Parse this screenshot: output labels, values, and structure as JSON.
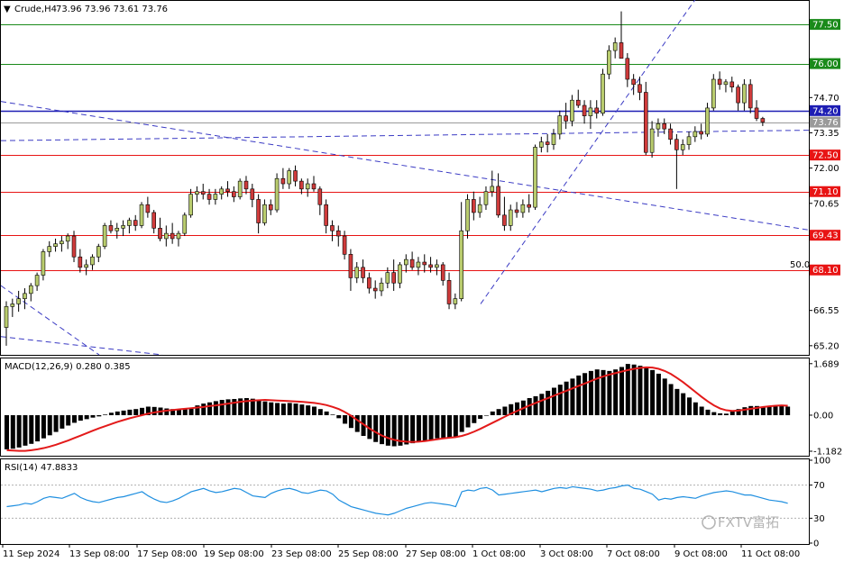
{
  "header": {
    "symbol": "Crude,H4",
    "ohlc": "73.96 73.96 73.61 73.76"
  },
  "watermark": "FXTV富拓",
  "colors": {
    "background": "#ffffff",
    "candle_up": "#b9cc6e",
    "candle_down": "#cf3b3b",
    "macd_hist": "#000000",
    "macd_signal": "#e31a1a",
    "rsi_line": "#1f8fe0",
    "green_level": "#1a8a1a",
    "red_level": "#e81414",
    "blue_level": "#1e1eb4",
    "gray_level": "#9a9a9a",
    "trend_dash": "#3b3bc4"
  },
  "chart_data": [
    {
      "type": "candlestick",
      "title": "Crude,H4",
      "x_ticks": [
        "11 Sep 2024",
        "13 Sep 08:00",
        "17 Sep 08:00",
        "19 Sep 08:00",
        "23 Sep 08:00",
        "25 Sep 08:00",
        "27 Sep 08:00",
        "1 Oct 08:00",
        "3 Oct 08:00",
        "7 Oct 08:00",
        "9 Oct 08:00",
        "11 Oct 08:00"
      ],
      "y_ticks": [
        65.2,
        66.55,
        70.65,
        72.0,
        73.35,
        74.7
      ],
      "ylim": [
        64.85,
        78.4
      ],
      "current_price": 73.76,
      "levels": [
        {
          "value": 77.5,
          "label": "77.50",
          "kind": "green"
        },
        {
          "value": 76.0,
          "label": "76.00",
          "kind": "green"
        },
        {
          "value": 74.2,
          "label": "74.20",
          "kind": "blue"
        },
        {
          "value": 73.76,
          "label": "73.76",
          "kind": "gray"
        },
        {
          "value": 72.5,
          "label": "72.50",
          "kind": "red"
        },
        {
          "value": 71.1,
          "label": "71.10",
          "kind": "red"
        },
        {
          "value": 69.43,
          "label": "69.43",
          "kind": "red"
        },
        {
          "value": 68.1,
          "label": "68.10",
          "kind": "red"
        }
      ],
      "fib_label": "50.0",
      "candles": [
        [
          65.9,
          66.9,
          65.2,
          66.7
        ],
        [
          66.7,
          67.0,
          66.3,
          66.8
        ],
        [
          66.8,
          67.3,
          66.5,
          67.0
        ],
        [
          67.0,
          67.4,
          66.6,
          67.2
        ],
        [
          67.2,
          67.6,
          66.9,
          67.5
        ],
        [
          67.5,
          68.0,
          67.3,
          67.9
        ],
        [
          67.9,
          68.9,
          67.7,
          68.8
        ],
        [
          68.8,
          69.2,
          68.6,
          69.0
        ],
        [
          69.0,
          69.3,
          68.8,
          69.1
        ],
        [
          69.1,
          69.4,
          68.8,
          69.2
        ],
        [
          69.2,
          69.5,
          68.9,
          69.4
        ],
        [
          69.4,
          69.6,
          68.4,
          68.6
        ],
        [
          68.6,
          68.9,
          68.0,
          68.2
        ],
        [
          68.2,
          68.5,
          67.9,
          68.3
        ],
        [
          68.3,
          68.7,
          68.1,
          68.6
        ],
        [
          68.6,
          69.1,
          68.4,
          69.0
        ],
        [
          69.0,
          69.9,
          68.9,
          69.8
        ],
        [
          69.8,
          70.0,
          69.5,
          69.6
        ],
        [
          69.6,
          69.9,
          69.3,
          69.7
        ],
        [
          69.7,
          70.0,
          69.4,
          69.8
        ],
        [
          69.8,
          70.1,
          69.5,
          70.0
        ],
        [
          70.0,
          70.2,
          69.6,
          69.8
        ],
        [
          69.8,
          70.7,
          69.7,
          70.6
        ],
        [
          70.6,
          70.9,
          70.1,
          70.3
        ],
        [
          70.3,
          70.4,
          69.5,
          69.7
        ],
        [
          69.7,
          70.1,
          69.2,
          69.3
        ],
        [
          69.3,
          69.8,
          69.0,
          69.5
        ],
        [
          69.5,
          69.9,
          69.1,
          69.3
        ],
        [
          69.3,
          69.6,
          69.0,
          69.5
        ],
        [
          69.5,
          70.3,
          69.4,
          70.2
        ],
        [
          70.2,
          71.2,
          70.1,
          71.0
        ],
        [
          71.0,
          71.3,
          70.7,
          71.1
        ],
        [
          71.1,
          71.4,
          70.8,
          71.0
        ],
        [
          71.0,
          71.2,
          70.6,
          70.8
        ],
        [
          70.8,
          71.2,
          70.6,
          71.0
        ],
        [
          71.0,
          71.3,
          70.8,
          71.2
        ],
        [
          71.2,
          71.5,
          70.9,
          71.1
        ],
        [
          71.1,
          71.3,
          70.7,
          70.9
        ],
        [
          70.9,
          71.6,
          70.8,
          71.5
        ],
        [
          71.5,
          71.7,
          71.0,
          71.2
        ],
        [
          71.2,
          71.4,
          70.5,
          70.8
        ],
        [
          70.8,
          71.0,
          69.5,
          69.9
        ],
        [
          69.9,
          70.8,
          69.8,
          70.6
        ],
        [
          70.6,
          70.8,
          70.2,
          70.4
        ],
        [
          70.4,
          71.8,
          70.3,
          71.6
        ],
        [
          71.6,
          72.0,
          71.2,
          71.4
        ],
        [
          71.4,
          72.0,
          71.2,
          71.9
        ],
        [
          71.9,
          72.1,
          71.3,
          71.5
        ],
        [
          71.5,
          71.6,
          71.0,
          71.2
        ],
        [
          71.2,
          71.6,
          70.9,
          71.4
        ],
        [
          71.4,
          71.7,
          71.1,
          71.2
        ],
        [
          71.2,
          71.3,
          70.2,
          70.6
        ],
        [
          70.6,
          70.8,
          69.5,
          69.8
        ],
        [
          69.8,
          70.0,
          69.2,
          69.6
        ],
        [
          69.6,
          69.8,
          69.0,
          69.4
        ],
        [
          69.4,
          69.6,
          68.5,
          68.7
        ],
        [
          68.7,
          68.9,
          67.3,
          67.8
        ],
        [
          67.8,
          68.4,
          67.6,
          68.2
        ],
        [
          68.2,
          68.5,
          67.6,
          67.8
        ],
        [
          67.8,
          68.0,
          67.2,
          67.4
        ],
        [
          67.4,
          67.7,
          67.0,
          67.3
        ],
        [
          67.3,
          67.8,
          67.1,
          67.6
        ],
        [
          67.6,
          68.2,
          67.4,
          68.0
        ],
        [
          68.0,
          68.5,
          67.3,
          67.6
        ],
        [
          67.6,
          68.4,
          67.4,
          68.3
        ],
        [
          68.3,
          68.7,
          68.0,
          68.5
        ],
        [
          68.5,
          68.8,
          68.1,
          68.2
        ],
        [
          68.2,
          68.6,
          67.9,
          68.4
        ],
        [
          68.4,
          68.7,
          68.0,
          68.3
        ],
        [
          68.3,
          68.6,
          68.0,
          68.2
        ],
        [
          68.2,
          68.5,
          67.9,
          68.3
        ],
        [
          68.3,
          68.4,
          67.5,
          67.7
        ],
        [
          67.7,
          68.0,
          66.6,
          66.8
        ],
        [
          66.8,
          67.2,
          66.6,
          67.0
        ],
        [
          67.0,
          70.7,
          66.9,
          69.6
        ],
        [
          69.6,
          71.0,
          69.3,
          70.8
        ],
        [
          70.8,
          71.1,
          70.0,
          70.3
        ],
        [
          70.3,
          70.9,
          70.1,
          70.6
        ],
        [
          70.6,
          71.3,
          70.4,
          71.1
        ],
        [
          71.1,
          71.9,
          70.9,
          71.3
        ],
        [
          71.3,
          71.8,
          70.1,
          70.2
        ],
        [
          70.2,
          70.9,
          69.6,
          69.8
        ],
        [
          69.8,
          70.6,
          69.6,
          70.4
        ],
        [
          70.4,
          70.7,
          70.1,
          70.3
        ],
        [
          70.3,
          70.8,
          70.1,
          70.6
        ],
        [
          70.6,
          71.0,
          70.3,
          70.5
        ],
        [
          70.5,
          72.9,
          70.4,
          72.8
        ],
        [
          72.8,
          73.2,
          72.6,
          73.0
        ],
        [
          73.0,
          73.3,
          72.6,
          72.9
        ],
        [
          72.9,
          73.5,
          72.7,
          73.3
        ],
        [
          73.3,
          74.2,
          73.1,
          74.0
        ],
        [
          74.0,
          74.5,
          73.5,
          73.8
        ],
        [
          73.8,
          74.8,
          73.6,
          74.6
        ],
        [
          74.6,
          75.0,
          74.3,
          74.4
        ],
        [
          74.4,
          74.6,
          73.7,
          74.0
        ],
        [
          74.0,
          74.6,
          73.5,
          74.3
        ],
        [
          74.3,
          74.6,
          73.9,
          74.1
        ],
        [
          74.1,
          75.8,
          74.0,
          75.6
        ],
        [
          75.6,
          76.7,
          75.4,
          76.5
        ],
        [
          76.5,
          77.0,
          76.2,
          76.8
        ],
        [
          76.8,
          78.0,
          76.4,
          76.2
        ],
        [
          76.2,
          76.4,
          75.1,
          75.4
        ],
        [
          75.4,
          75.6,
          74.8,
          75.2
        ],
        [
          75.2,
          75.5,
          74.6,
          74.9
        ],
        [
          74.9,
          75.3,
          72.5,
          72.6
        ],
        [
          72.6,
          73.8,
          72.4,
          73.5
        ],
        [
          73.5,
          73.9,
          73.2,
          73.7
        ],
        [
          73.7,
          73.9,
          73.3,
          73.5
        ],
        [
          73.5,
          73.7,
          72.9,
          73.1
        ],
        [
          73.1,
          73.3,
          71.2,
          72.7
        ],
        [
          72.7,
          73.1,
          72.5,
          72.9
        ],
        [
          72.9,
          73.4,
          72.7,
          73.2
        ],
        [
          73.2,
          73.6,
          73.0,
          73.4
        ],
        [
          73.4,
          73.7,
          73.1,
          73.3
        ],
        [
          73.3,
          74.5,
          73.2,
          74.3
        ],
        [
          74.3,
          75.6,
          74.2,
          75.4
        ],
        [
          75.4,
          75.7,
          75.0,
          75.2
        ],
        [
          75.2,
          75.4,
          74.9,
          75.3
        ],
        [
          75.3,
          75.5,
          74.9,
          75.1
        ],
        [
          75.1,
          75.2,
          74.2,
          74.5
        ],
        [
          74.5,
          75.4,
          74.2,
          75.2
        ],
        [
          75.2,
          75.4,
          74.1,
          74.3
        ],
        [
          74.3,
          74.6,
          73.8,
          73.9
        ],
        [
          73.9,
          73.96,
          73.61,
          73.76
        ]
      ]
    },
    {
      "type": "histogram+line",
      "title": "MACD(12,26,9) 0.280 0.385",
      "y_ticks": [
        1.689,
        0.0,
        -1.182
      ],
      "ylim": [
        -1.33,
        1.86
      ],
      "hist": [
        -1.12,
        -1.1,
        -1.06,
        -1.0,
        -0.94,
        -0.86,
        -0.76,
        -0.66,
        -0.55,
        -0.44,
        -0.34,
        -0.25,
        -0.18,
        -0.13,
        -0.08,
        -0.04,
        0.02,
        0.08,
        0.12,
        0.15,
        0.18,
        0.2,
        0.24,
        0.28,
        0.27,
        0.25,
        0.22,
        0.2,
        0.18,
        0.2,
        0.25,
        0.32,
        0.38,
        0.42,
        0.46,
        0.5,
        0.52,
        0.53,
        0.55,
        0.56,
        0.54,
        0.48,
        0.45,
        0.42,
        0.4,
        0.38,
        0.4,
        0.38,
        0.35,
        0.32,
        0.28,
        0.2,
        0.12,
        0.02,
        -0.1,
        -0.28,
        -0.42,
        -0.55,
        -0.68,
        -0.78,
        -0.88,
        -0.95,
        -1.0,
        -1.02,
        -1.0,
        -0.96,
        -0.92,
        -0.88,
        -0.84,
        -0.8,
        -0.76,
        -0.74,
        -0.73,
        -0.7,
        -0.55,
        -0.4,
        -0.26,
        -0.12,
        0.0,
        0.12,
        0.2,
        0.28,
        0.36,
        0.42,
        0.48,
        0.56,
        0.62,
        0.7,
        0.8,
        0.9,
        1.0,
        1.1,
        1.2,
        1.3,
        1.38,
        1.45,
        1.5,
        1.48,
        1.45,
        1.5,
        1.58,
        1.68,
        1.66,
        1.62,
        1.56,
        1.48,
        1.36,
        1.2,
        1.02,
        0.86,
        0.72,
        0.58,
        0.42,
        0.28,
        0.18,
        0.1,
        0.06,
        0.05,
        0.12,
        0.2,
        0.26,
        0.3,
        0.3,
        0.28,
        0.3,
        0.32,
        0.3,
        0.28
      ],
      "signal": [
        -1.15,
        -1.16,
        -1.17,
        -1.17,
        -1.15,
        -1.12,
        -1.08,
        -1.03,
        -0.97,
        -0.9,
        -0.83,
        -0.75,
        -0.67,
        -0.59,
        -0.51,
        -0.43,
        -0.36,
        -0.29,
        -0.22,
        -0.16,
        -0.1,
        -0.05,
        0.0,
        0.05,
        0.09,
        0.12,
        0.15,
        0.17,
        0.19,
        0.21,
        0.23,
        0.25,
        0.27,
        0.3,
        0.32,
        0.35,
        0.38,
        0.41,
        0.44,
        0.46,
        0.48,
        0.49,
        0.5,
        0.49,
        0.48,
        0.47,
        0.46,
        0.45,
        0.44,
        0.42,
        0.4,
        0.37,
        0.33,
        0.27,
        0.2,
        0.1,
        -0.02,
        -0.16,
        -0.3,
        -0.44,
        -0.56,
        -0.67,
        -0.75,
        -0.81,
        -0.85,
        -0.87,
        -0.88,
        -0.87,
        -0.85,
        -0.82,
        -0.79,
        -0.76,
        -0.74,
        -0.72,
        -0.68,
        -0.62,
        -0.54,
        -0.45,
        -0.35,
        -0.25,
        -0.15,
        -0.05,
        0.05,
        0.14,
        0.23,
        0.32,
        0.4,
        0.48,
        0.56,
        0.64,
        0.72,
        0.8,
        0.88,
        0.96,
        1.04,
        1.12,
        1.2,
        1.27,
        1.33,
        1.38,
        1.43,
        1.48,
        1.52,
        1.55,
        1.57,
        1.56,
        1.52,
        1.45,
        1.35,
        1.22,
        1.08,
        0.92,
        0.76,
        0.6,
        0.45,
        0.32,
        0.22,
        0.16,
        0.14,
        0.15,
        0.18,
        0.21,
        0.24,
        0.27,
        0.29,
        0.31,
        0.32,
        0.31
      ]
    },
    {
      "type": "line",
      "title": "RSI(14) 47.8833",
      "y_ticks": [
        100,
        70,
        30,
        0
      ],
      "ylim": [
        0,
        100
      ],
      "values": [
        44,
        45,
        46,
        48,
        47,
        50,
        54,
        56,
        55,
        54,
        57,
        60,
        55,
        52,
        50,
        49,
        51,
        53,
        55,
        56,
        58,
        60,
        62,
        57,
        53,
        50,
        49,
        51,
        54,
        58,
        62,
        64,
        66,
        63,
        61,
        62,
        64,
        66,
        65,
        61,
        57,
        56,
        55,
        60,
        63,
        65,
        66,
        64,
        61,
        60,
        62,
        64,
        63,
        59,
        52,
        48,
        44,
        42,
        40,
        38,
        36,
        35,
        34,
        36,
        39,
        42,
        44,
        46,
        48,
        49,
        48,
        47,
        46,
        44,
        62,
        64,
        63,
        66,
        67,
        64,
        58,
        59,
        60,
        61,
        62,
        63,
        64,
        62,
        64,
        66,
        67,
        66,
        68,
        67,
        66,
        65,
        63,
        64,
        66,
        67,
        69,
        70,
        66,
        65,
        62,
        59,
        52,
        54,
        53,
        55,
        56,
        55,
        54,
        57,
        59,
        61,
        62,
        63,
        62,
        60,
        58,
        58,
        56,
        54,
        52,
        51,
        50,
        48
      ]
    }
  ]
}
